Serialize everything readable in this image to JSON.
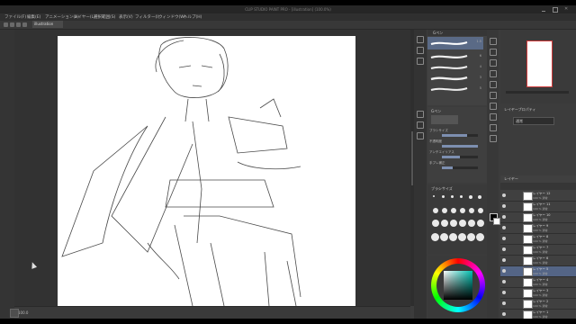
{
  "title_bar": {
    "text": "CLIP STUDIO PAINT PRO - [illustration] (100.0%)"
  },
  "menu": {
    "items": [
      "ファイル(F)",
      "編集(E)",
      "アニメーション(A)",
      "レイヤー(L)",
      "選択範囲(S)",
      "表示(V)",
      "フィルター(I)",
      "ウィンドウ(W)",
      "ヘルプ(H)"
    ]
  },
  "document_tab": {
    "label": "illustration"
  },
  "status": {
    "zoom": "100.0"
  },
  "brush_panel": {
    "header": "Gペン",
    "brushes": [
      {
        "name": "Gペン",
        "size": "1.5"
      },
      {
        "name": "丸ペン",
        "size": "6"
      },
      {
        "name": "カブラペン",
        "size": "4"
      },
      {
        "name": "リアルGペン",
        "size": "3"
      },
      {
        "name": "ミリペン",
        "size": "5"
      }
    ]
  },
  "tool_property": {
    "header": "Gペン",
    "rows": [
      {
        "label": "ブラシサイズ",
        "value": 0.7
      },
      {
        "label": "不透明度",
        "value": 1.0
      },
      {
        "label": "アンチエイリアス",
        "value": 0.5
      },
      {
        "label": "手ブレ補正",
        "value": 0.3
      }
    ]
  },
  "brush_size_palette": {
    "header": "ブラシサイズ"
  },
  "layer_property": {
    "header": "レイヤープロパティ",
    "blend_mode": "通常"
  },
  "layers": {
    "header": "レイヤー",
    "items": [
      {
        "name": "レイヤー 12",
        "sub": "100 % 通常"
      },
      {
        "name": "レイヤー 11",
        "sub": "100 % 通常"
      },
      {
        "name": "レイヤー 10",
        "sub": "100 % 通常"
      },
      {
        "name": "レイヤー 9",
        "sub": "100 % 通常"
      },
      {
        "name": "レイヤー 8",
        "sub": "100 % 通常"
      },
      {
        "name": "レイヤー 7",
        "sub": "100 % 通常"
      },
      {
        "name": "レイヤー 6",
        "sub": "100 % 通常"
      },
      {
        "name": "レイヤー 5",
        "sub": "100 % 通常"
      },
      {
        "name": "レイヤー 4",
        "sub": "100 % 通常"
      },
      {
        "name": "レイヤー 3",
        "sub": "100 % 通常"
      },
      {
        "name": "レイヤー 2",
        "sub": "100 % 通常"
      },
      {
        "name": "レイヤー 1",
        "sub": "100 % 通常"
      }
    ],
    "selected_index": 7
  },
  "colors": {
    "foreground": "#000000",
    "background": "#ffffff",
    "selection_accent": "#546586",
    "ui_background": "#3c3c3c"
  },
  "icons": {
    "left_strip": [
      "search-icon",
      "hand-icon",
      "pen-icon",
      "pencil-icon",
      "brush-icon",
      "airbrush-icon",
      "eraser-icon",
      "fill-icon",
      "gradient-icon",
      "text-icon"
    ],
    "right_strip": [
      "move-icon",
      "select-icon",
      "lasso-icon",
      "pen-icon",
      "eraser-icon",
      "fill-icon",
      "eyedropper-icon",
      "text-icon",
      "ruler-icon",
      "frame-icon"
    ]
  }
}
